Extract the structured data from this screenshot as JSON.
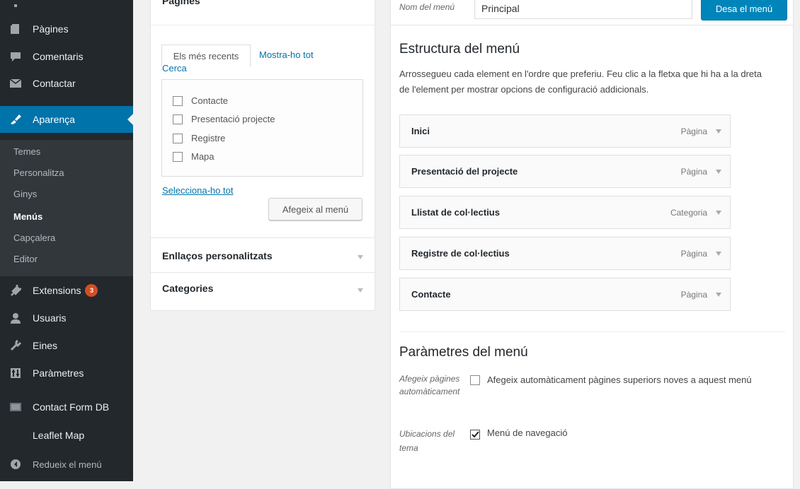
{
  "sidebar": {
    "items_top": [
      {
        "label": "Pàgines",
        "icon": "pages-icon"
      },
      {
        "label": "Comentaris",
        "icon": "comments-icon"
      },
      {
        "label": "Contactar",
        "icon": "mail-icon"
      }
    ],
    "active": {
      "label": "Aparença",
      "icon": "appearance-icon"
    },
    "submenu": [
      "Temes",
      "Personalitza",
      "Ginys",
      "Menús",
      "Capçalera",
      "Editor"
    ],
    "items_bottom": [
      {
        "label": "Extensions",
        "icon": "plugins-icon",
        "badge": "3"
      },
      {
        "label": "Usuaris",
        "icon": "users-icon"
      },
      {
        "label": "Eines",
        "icon": "tools-icon"
      },
      {
        "label": "Paràmetres",
        "icon": "settings-icon"
      },
      {
        "label": "Contact Form DB",
        "icon": "database-icon"
      },
      {
        "label": "Leaflet Map",
        "icon": ""
      }
    ],
    "collapse_label": "Redueix el menú"
  },
  "pages_panel": {
    "title": "Pàgines",
    "tab_recent": "Els més recents",
    "tab_all": "Mostra-ho tot",
    "tab_search": "Cerca",
    "pages": [
      "Contacte",
      "Presentació projecte",
      "Registre",
      "Mapa"
    ],
    "select_all": "Selecciona-ho tot",
    "add_button": "Afegeix al menú"
  },
  "custom_links_title": "Enllaços personalitzats",
  "categories_title": "Categories",
  "menu_header": {
    "name_label": "Nom del menú",
    "name_value": "Principal",
    "save_button": "Desa el menú"
  },
  "structure": {
    "title": "Estructura del menú",
    "description": "Arrossegueu cada element en l'ordre que preferiu. Feu clic a la fletxa que hi ha a la dreta de l'element per mostrar opcions de configuració addicionals.",
    "items": [
      {
        "title": "Inici",
        "type": "Pàgina"
      },
      {
        "title": "Presentació del projecte",
        "type": "Pàgina"
      },
      {
        "title": "Llistat de col·lectius",
        "type": "Categoria"
      },
      {
        "title": "Registre de col·lectius",
        "type": "Pàgina"
      },
      {
        "title": "Contacte",
        "type": "Pàgina"
      }
    ]
  },
  "settings": {
    "title": "Paràmetres del menú",
    "auto_label": "Afegeix pàgines automàticament",
    "auto_option": "Afegeix automàticament pàgines superiors noves a aquest menú",
    "auto_checked": false,
    "locations_label": "Ubicacions del tema",
    "location_option": "Menú de navegació",
    "location_checked": true
  }
}
